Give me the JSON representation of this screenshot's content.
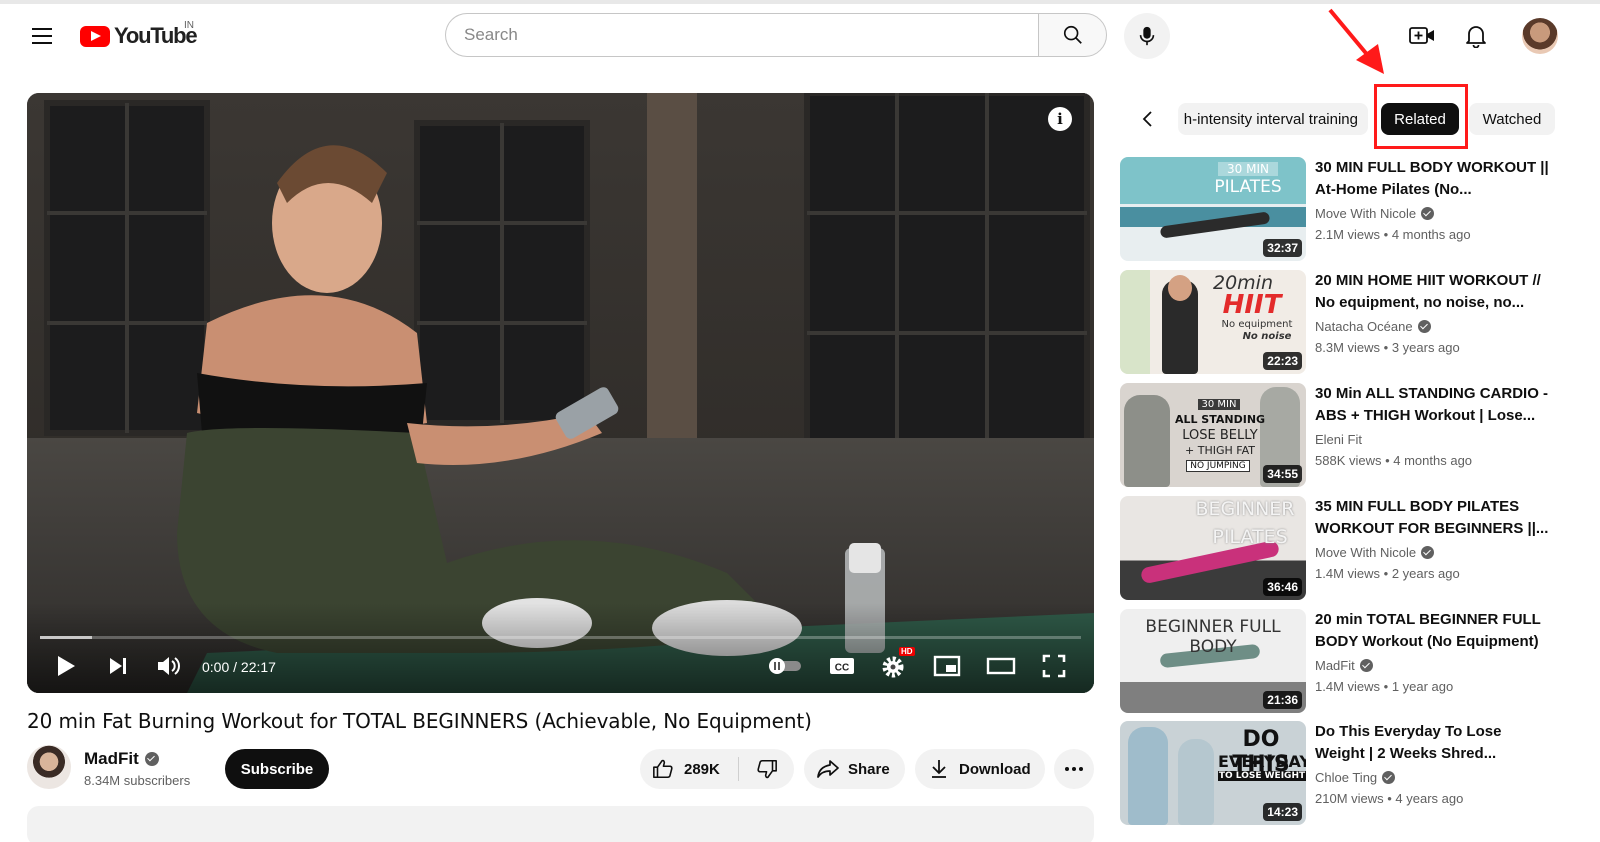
{
  "header": {
    "logo_text": "YouTube",
    "region": "IN",
    "search_placeholder": "Search"
  },
  "player": {
    "current_time": "0:00",
    "separator": " / ",
    "duration": "22:17",
    "progress_fraction": 0.05,
    "hd_badge": "HD",
    "info_glyph": "i"
  },
  "video": {
    "title": "20 min Fat Burning Workout for TOTAL BEGINNERS (Achievable, No Equipment)",
    "channel": "MadFit",
    "subscribers": "8.34M subscribers",
    "subscribe_label": "Subscribe",
    "likes": "289K",
    "share_label": "Share",
    "download_label": "Download"
  },
  "chips": {
    "hiit": "h-intensity interval training",
    "related": "Related",
    "watched": "Watched"
  },
  "related": [
    {
      "title": "30 MIN FULL BODY WORKOUT || At-Home Pilates (No...",
      "channel": "Move With Nicole",
      "verified": true,
      "views": "2.1M views",
      "age": "4 months ago",
      "duration": "32:37",
      "thumb_lines": [
        "30 MIN",
        "PILATES"
      ]
    },
    {
      "title": "20 MIN HOME HIIT WORKOUT // No equipment, no noise, no...",
      "channel": "Natacha Océane",
      "verified": true,
      "views": "8.3M views",
      "age": "3 years ago",
      "duration": "22:23",
      "thumb_lines": [
        "20min",
        "HIIT",
        "No equipment",
        "No noise"
      ]
    },
    {
      "title": "30 Min ALL STANDING CARDIO - ABS + THIGH Workout | Lose...",
      "channel": "Eleni Fit",
      "verified": false,
      "views": "588K views",
      "age": "4 months ago",
      "duration": "34:55",
      "thumb_lines": [
        "30 MIN",
        "ALL STANDING",
        "LOSE BELLY",
        "+ THIGH FAT",
        "NO JUMPING"
      ]
    },
    {
      "title": "35 MIN FULL BODY PILATES WORKOUT FOR BEGINNERS ||...",
      "channel": "Move With Nicole",
      "verified": true,
      "views": "1.4M views",
      "age": "2 years ago",
      "duration": "36:46",
      "thumb_lines": [
        "BEGINNER",
        "PILATES"
      ]
    },
    {
      "title": "20 min TOTAL BEGINNER FULL BODY Workout (No Equipment)",
      "channel": "MadFit",
      "verified": true,
      "views": "1.4M views",
      "age": "1 year ago",
      "duration": "21:36",
      "thumb_lines": [
        "BEGINNER FULL BODY"
      ]
    },
    {
      "title": "Do This Everyday To Lose Weight | 2 Weeks Shred...",
      "channel": "Chloe Ting",
      "verified": true,
      "views": "210M views",
      "age": "4 years ago",
      "duration": "14:23",
      "thumb_lines": [
        "DO THIS",
        "EVERYDAY",
        "TO LOSE WEIGHT"
      ]
    }
  ],
  "colors": {
    "brand_red": "#ff0000",
    "annotation_red": "#ff1a1a",
    "active_chip": "#0f0f0f",
    "pill_bg": "#f2f2f2"
  },
  "icons": {
    "menu": "hamburger-icon",
    "search": "search-icon",
    "mic": "mic-icon",
    "create": "create-video-icon",
    "notifications": "bell-icon",
    "like": "thumbs-up-icon",
    "dislike": "thumbs-down-icon",
    "share": "share-icon",
    "download": "download-icon",
    "more": "more-horizontal-icon"
  }
}
